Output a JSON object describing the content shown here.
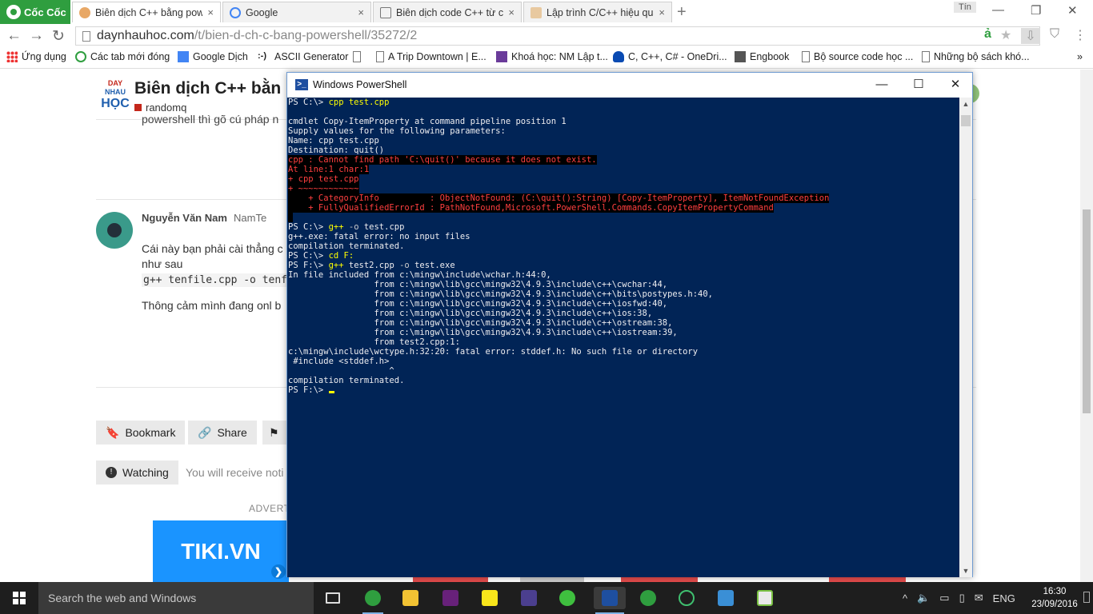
{
  "browser": {
    "brand": "Cốc Cốc",
    "tabs": [
      {
        "title": "Biên dịch C++ bằng powe",
        "active": true
      },
      {
        "title": "Google",
        "active": false
      },
      {
        "title": "Biên dịch code C++ từ con",
        "active": false
      },
      {
        "title": "Lập trình C/C++ hiệu quả",
        "active": false
      }
    ],
    "tab_close": "×",
    "new_tab": "+",
    "user_badge": "Tín",
    "address": {
      "host": "daynhauhoc.com",
      "path": "/t/bien-d-ch-c-bang-powershell/35272/2"
    },
    "bookmarks": [
      {
        "label": "Ứng dụng",
        "icon": "apps-grid-icon"
      },
      {
        "label": "Các tab mới đóng",
        "icon": "history-icon"
      },
      {
        "label": "Google Dịch",
        "icon": "translate-icon"
      },
      {
        "label": "ASCII Generator",
        "icon": "ascii-icon"
      },
      {
        "label": "",
        "icon": "page-icon"
      },
      {
        "label": "A Trip Downtown | E...",
        "icon": "page-icon"
      },
      {
        "label": "Khoá học: NM Lập t...",
        "icon": "course-icon"
      },
      {
        "label": "C, C++, C# - OneDri...",
        "icon": "onedrive-icon"
      },
      {
        "label": "Engbook",
        "icon": "folder-icon"
      },
      {
        "label": "Bộ source code học ...",
        "icon": "page-icon"
      },
      {
        "label": "Những bộ sách khó...",
        "icon": "page-icon"
      }
    ],
    "more": "»"
  },
  "webpage": {
    "logo": {
      "line1": "DAY",
      "line2": "NHAU",
      "line3": "HỌC"
    },
    "topic_title": "Biên dịch C++ bằn",
    "category": "randomq",
    "snippet": "powershell thì gõ cú pháp n",
    "reply": {
      "author": "Nguyễn Văn Nam",
      "handle": "NamTe",
      "text1": "Cái này bạn phải cài thẳng c",
      "text2": "như sau",
      "code": "g++ tenfile.cpp -o tenfi",
      "text3": "Thông cảm mình đang onl b"
    },
    "buttons": {
      "bookmark": "Bookmark",
      "share": "Share",
      "flag": "",
      "watching": "Watching"
    },
    "watching_note": "You will receive noti",
    "ad_label": "ADVERT",
    "ad_brand": "TIKI.VN",
    "ad_next": "❯"
  },
  "powershell": {
    "title": "Windows PowerShell",
    "controls": {
      "minimize": "—",
      "maximize": "☐",
      "close": "✕"
    },
    "lines": [
      [
        [
          "t",
          "PS C:\\> "
        ],
        [
          "c",
          "cpp test.cpp"
        ]
      ],
      [],
      [
        [
          "t",
          "cmdlet Copy-ItemProperty at command pipeline position 1"
        ]
      ],
      [
        [
          "t",
          "Supply values for the following parameters:"
        ]
      ],
      [
        [
          "t",
          "Name: cpp test.cpp"
        ]
      ],
      [
        [
          "t",
          "Destination: quit()"
        ]
      ],
      [
        [
          "e",
          "cpp : Cannot find path 'C:\\quit()' because it does not exist."
        ]
      ],
      [
        [
          "e",
          "At line:1 char:1"
        ]
      ],
      [
        [
          "e",
          "+ cpp test.cpp"
        ]
      ],
      [
        [
          "e",
          "+ ~~~~~~~~~~~~"
        ]
      ],
      [
        [
          "e",
          "    + CategoryInfo          : ObjectNotFound: (C:\\quit():String) [Copy-ItemProperty], ItemNotFoundException"
        ]
      ],
      [
        [
          "e",
          "    + FullyQualifiedErrorId : PathNotFound,Microsoft.PowerShell.Commands.CopyItemPropertyCommand"
        ]
      ],
      [
        [
          "e",
          " "
        ]
      ],
      [
        [
          "t",
          "PS C:\\> "
        ],
        [
          "c",
          "g++ "
        ],
        [
          "p",
          "-o "
        ],
        [
          "t",
          "test.cpp"
        ]
      ],
      [
        [
          "t",
          "g++.exe: fatal error: no input files"
        ]
      ],
      [
        [
          "t",
          "compilation terminated."
        ]
      ],
      [
        [
          "t",
          "PS C:\\> "
        ],
        [
          "c",
          "cd F:"
        ]
      ],
      [
        [
          "t",
          "PS F:\\> "
        ],
        [
          "c",
          "g++ "
        ],
        [
          "t",
          "test2.cpp "
        ],
        [
          "p",
          "-o "
        ],
        [
          "t",
          "test.exe"
        ]
      ],
      [
        [
          "t",
          "In file included from c:\\mingw\\include\\wchar.h:44:0,"
        ]
      ],
      [
        [
          "t",
          "                 from c:\\mingw\\lib\\gcc\\mingw32\\4.9.3\\include\\c++\\cwchar:44,"
        ]
      ],
      [
        [
          "t",
          "                 from c:\\mingw\\lib\\gcc\\mingw32\\4.9.3\\include\\c++\\bits\\postypes.h:40,"
        ]
      ],
      [
        [
          "t",
          "                 from c:\\mingw\\lib\\gcc\\mingw32\\4.9.3\\include\\c++\\iosfwd:40,"
        ]
      ],
      [
        [
          "t",
          "                 from c:\\mingw\\lib\\gcc\\mingw32\\4.9.3\\include\\c++\\ios:38,"
        ]
      ],
      [
        [
          "t",
          "                 from c:\\mingw\\lib\\gcc\\mingw32\\4.9.3\\include\\c++\\ostream:38,"
        ]
      ],
      [
        [
          "t",
          "                 from c:\\mingw\\lib\\gcc\\mingw32\\4.9.3\\include\\c++\\iostream:39,"
        ]
      ],
      [
        [
          "t",
          "                 from test2.cpp:1:"
        ]
      ],
      [
        [
          "t",
          "c:\\mingw\\include\\wctype.h:32:20: fatal error: stddef.h: No such file or directory"
        ]
      ],
      [
        [
          "t",
          " #include <stddef.h>"
        ]
      ],
      [
        [
          "t",
          "                    ^"
        ]
      ],
      [
        [
          "t",
          "compilation terminated."
        ]
      ],
      [
        [
          "t",
          "PS F:\\> "
        ],
        [
          "cursor",
          ""
        ]
      ]
    ]
  },
  "taskbar": {
    "search_placeholder": "Search the web and Windows",
    "language": "ENG",
    "time": "16:30",
    "date": "23/09/2016",
    "tray_expand": "^"
  },
  "colors": {
    "console_bg": "#012456",
    "console_text": "#eeedf0",
    "console_command": "#ffff00",
    "console_error": "#ff3f3f",
    "brand_green": "#2f9e3f"
  }
}
